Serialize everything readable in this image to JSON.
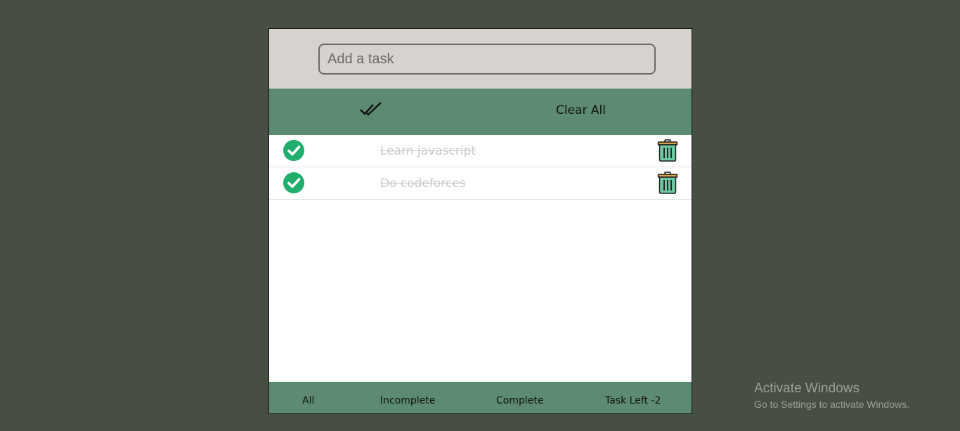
{
  "input": {
    "placeholder": "Add a task",
    "value": ""
  },
  "toolbar": {
    "complete_all_icon": "double-check-icon",
    "clear_all_label": "Clear All"
  },
  "tasks": [
    {
      "text": "Learn javascript",
      "completed": true
    },
    {
      "text": "Do codeforces",
      "completed": true
    }
  ],
  "footer": {
    "all": "All",
    "incomplete": "Incomplete",
    "complete": "Complete",
    "task_left": "Task Left -2"
  },
  "watermark": {
    "title": "Activate Windows",
    "subtitle": "Go to Settings to activate Windows."
  },
  "colors": {
    "page_background": "#474e42",
    "header_background": "#d6d2ce",
    "accent_green": "#5c8b72",
    "check_green": "#1fae6b",
    "completed_text": "#c9c9c9"
  }
}
